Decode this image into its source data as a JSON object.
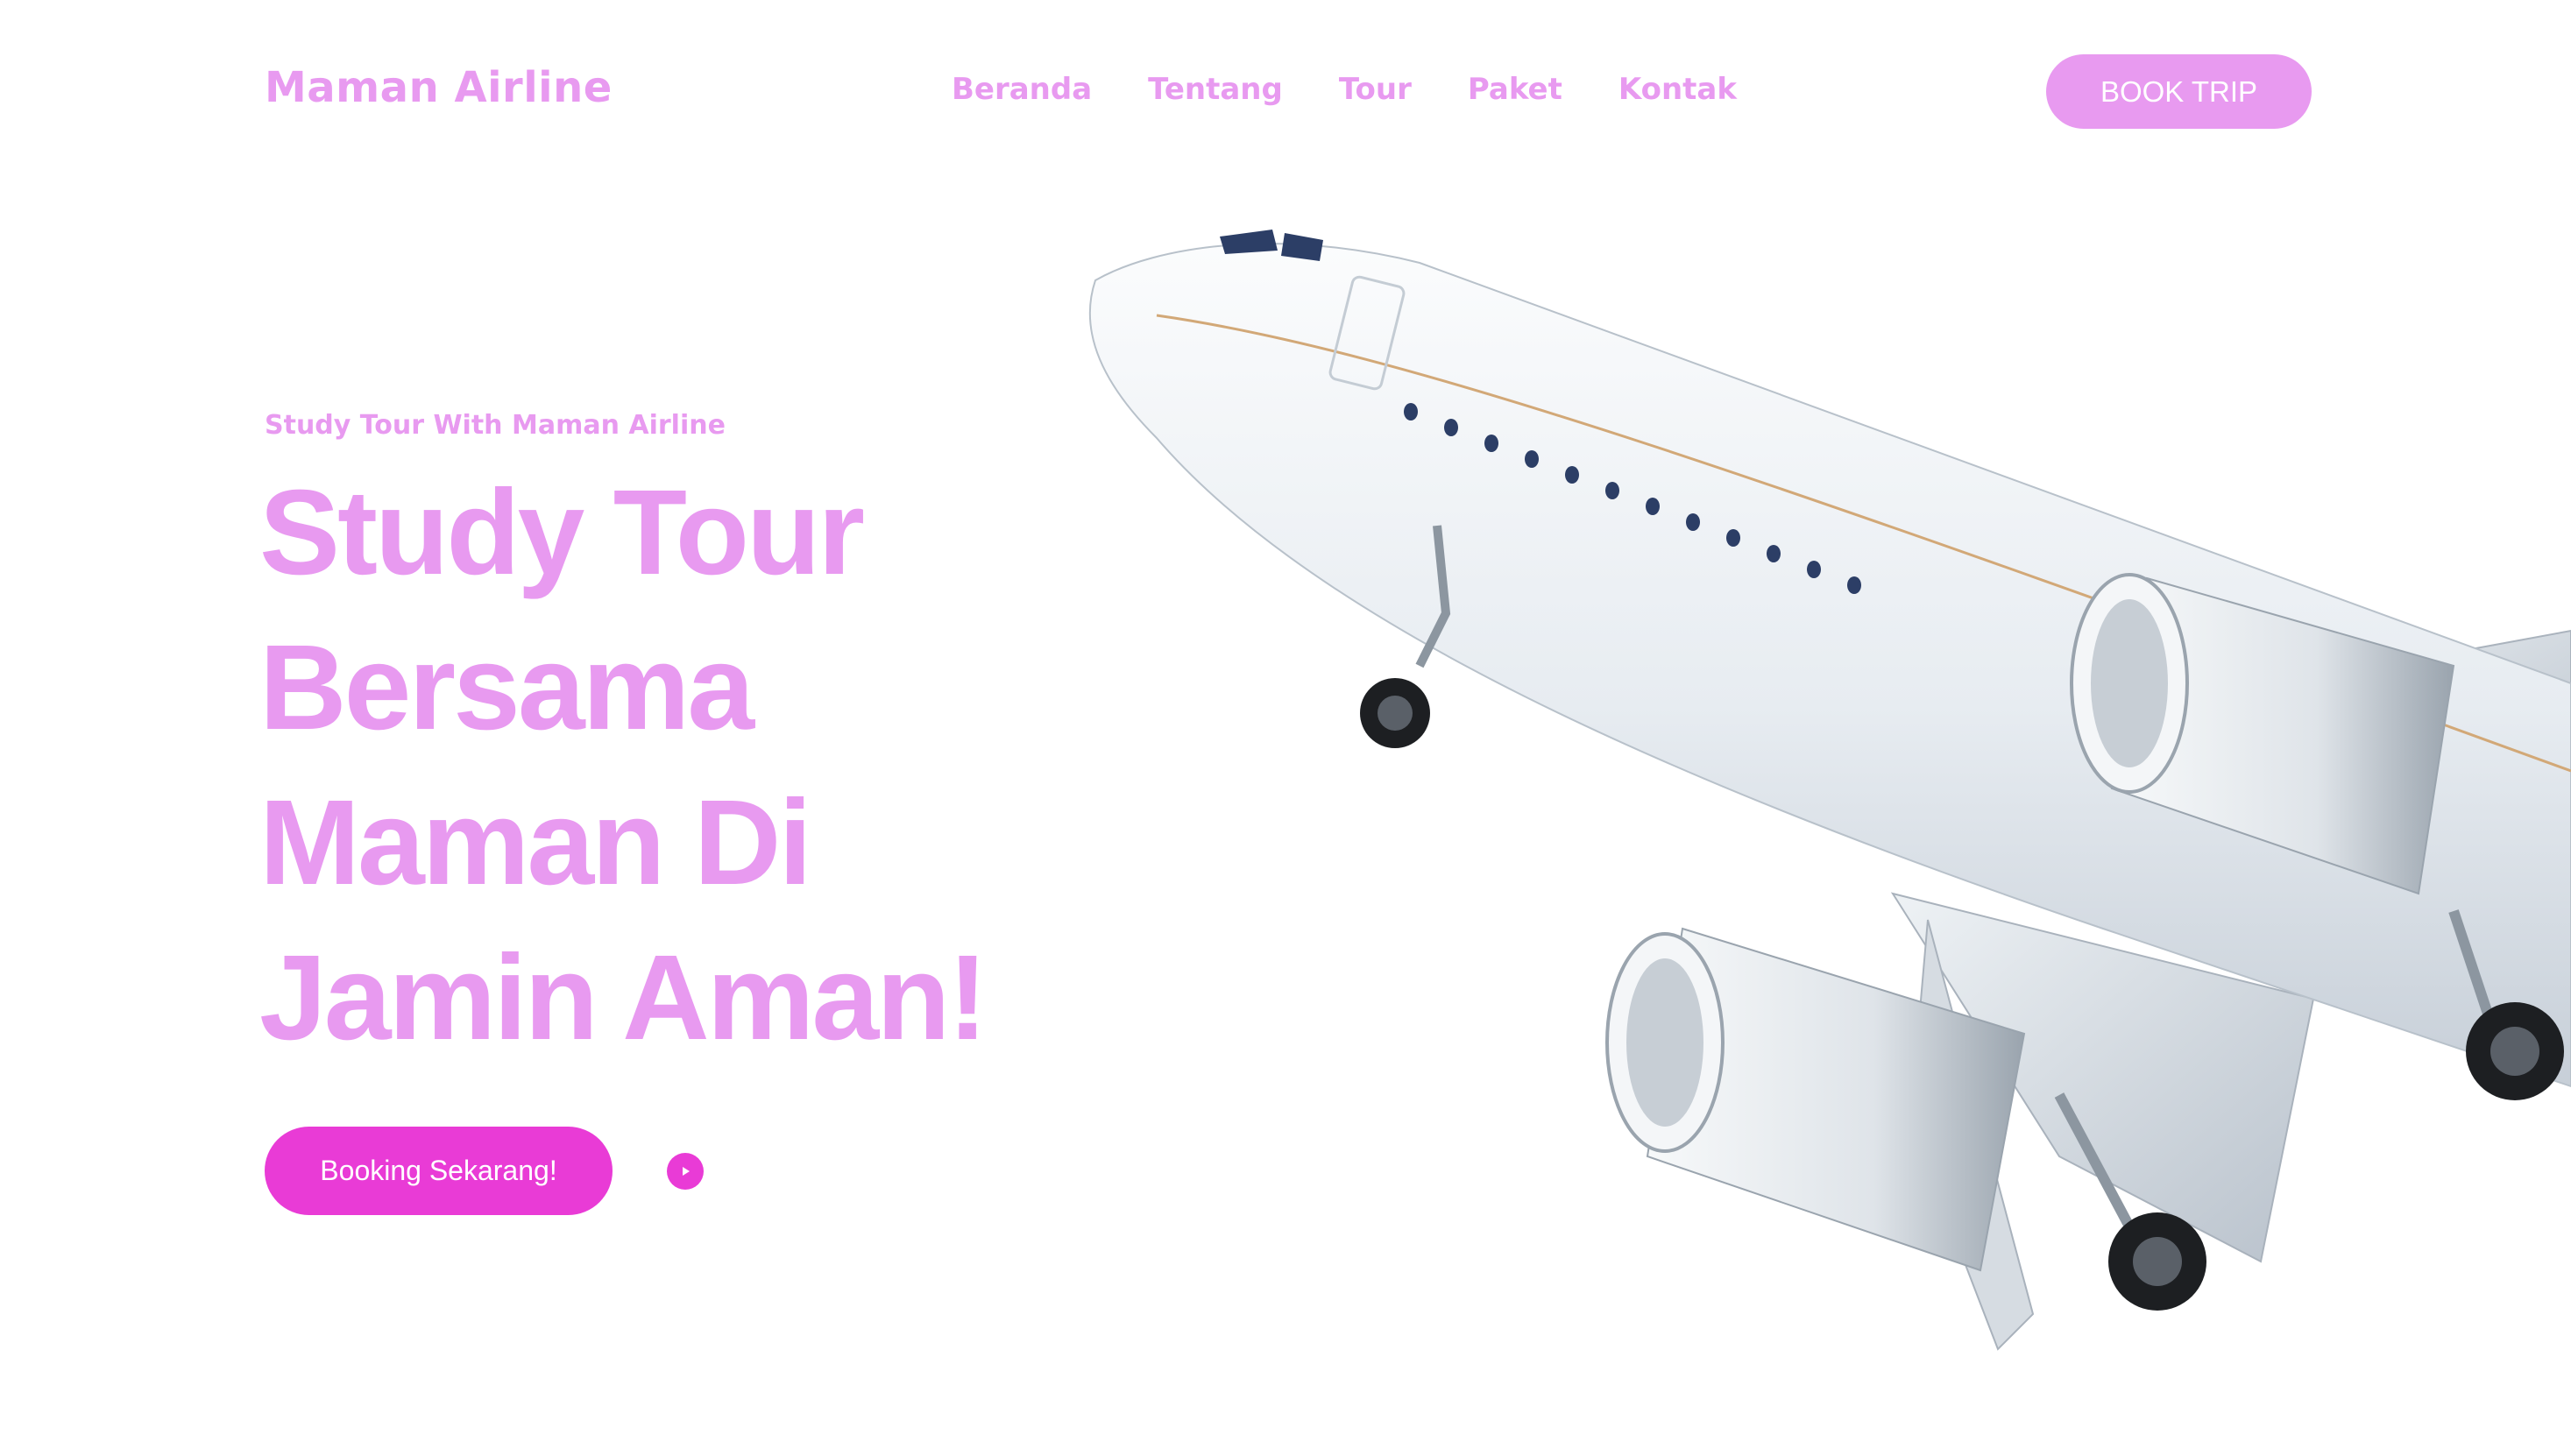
{
  "brand": {
    "name": "Maman Airline"
  },
  "nav": {
    "items": [
      "Beranda",
      "Tentang",
      "Tour",
      "Paket",
      "Kontak"
    ],
    "cta_label": "BOOK TRIP"
  },
  "hero": {
    "eyebrow": "Study Tour With Maman Airline",
    "headline_lines": [
      "Study Tour",
      "Bersama",
      "Maman Di",
      "Jamin Aman!"
    ],
    "cta_label": "Booking Sekarang!",
    "play_icon": "play-icon",
    "image_subject": "airplane-image"
  },
  "colors": {
    "accent_light": "#e89af0",
    "accent_strong": "#e93bd6",
    "background": "#ffffff"
  }
}
